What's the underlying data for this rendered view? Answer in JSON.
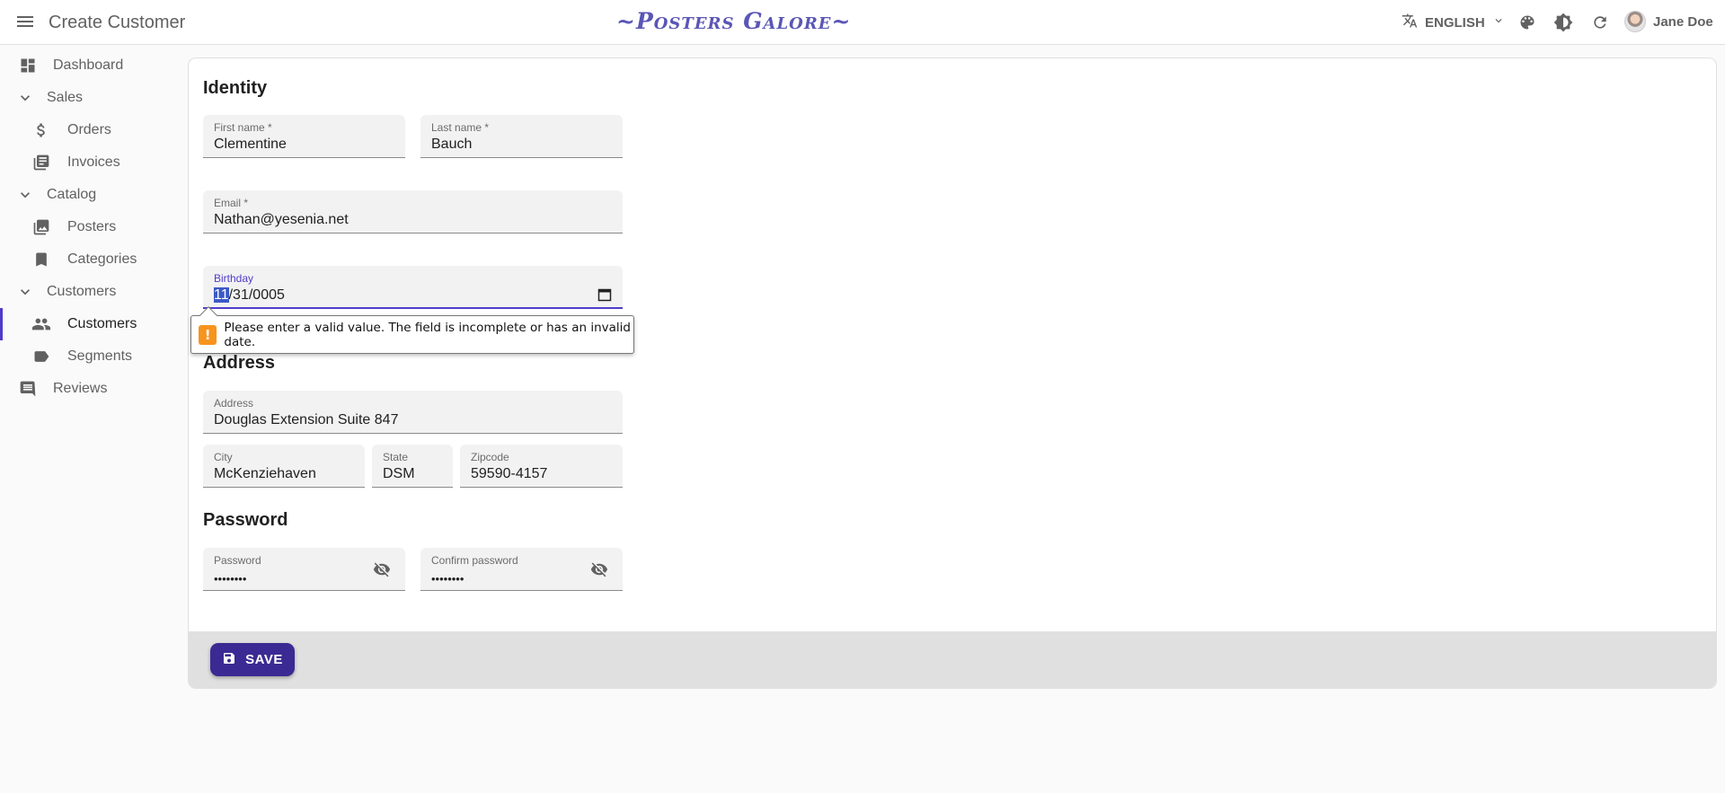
{
  "header": {
    "page_title": "Create Customer",
    "brand": "~Posters Galore~",
    "language": "ENGLISH",
    "user_name": "Jane Doe"
  },
  "sidebar": {
    "items": [
      {
        "label": "Dashboard",
        "icon": "dashboard-icon"
      },
      {
        "label": "Sales",
        "icon": "chevron-down-icon"
      },
      {
        "label": "Orders",
        "icon": "dollar-icon"
      },
      {
        "label": "Invoices",
        "icon": "library-books-icon"
      },
      {
        "label": "Catalog",
        "icon": "chevron-down-icon"
      },
      {
        "label": "Posters",
        "icon": "collections-icon"
      },
      {
        "label": "Categories",
        "icon": "bookmark-icon"
      },
      {
        "label": "Customers",
        "icon": "chevron-down-icon"
      },
      {
        "label": "Customers",
        "icon": "people-icon",
        "active": true
      },
      {
        "label": "Segments",
        "icon": "label-icon"
      },
      {
        "label": "Reviews",
        "icon": "comment-icon"
      }
    ]
  },
  "form": {
    "identity": {
      "title": "Identity",
      "first_name": {
        "label": "First name *",
        "value": "Clementine"
      },
      "last_name": {
        "label": "Last name *",
        "value": "Bauch"
      },
      "email": {
        "label": "Email *",
        "value": "Nathan@yesenia.net"
      },
      "birthday": {
        "label": "Birthday",
        "month": "11",
        "rest": "/31/0005"
      }
    },
    "validation_tooltip": "Please enter a valid value. The field is incomplete or has an invalid date.",
    "address": {
      "title": "Address",
      "address": {
        "label": "Address",
        "value": "Douglas Extension Suite 847"
      },
      "city": {
        "label": "City",
        "value": "McKenziehaven"
      },
      "state": {
        "label": "State",
        "value": "DSM"
      },
      "zipcode": {
        "label": "Zipcode",
        "value": "59590-4157"
      }
    },
    "password": {
      "title": "Password",
      "password": {
        "label": "Password",
        "value": "••••••••"
      },
      "confirm": {
        "label": "Confirm password",
        "value": "••••••••"
      }
    }
  },
  "toolbar": {
    "save_label": "SAVE"
  },
  "colors": {
    "accent": "#4f3cc9",
    "brand": "#5a56b6",
    "save_button": "#3b2a93",
    "warning": "#f7941d"
  }
}
